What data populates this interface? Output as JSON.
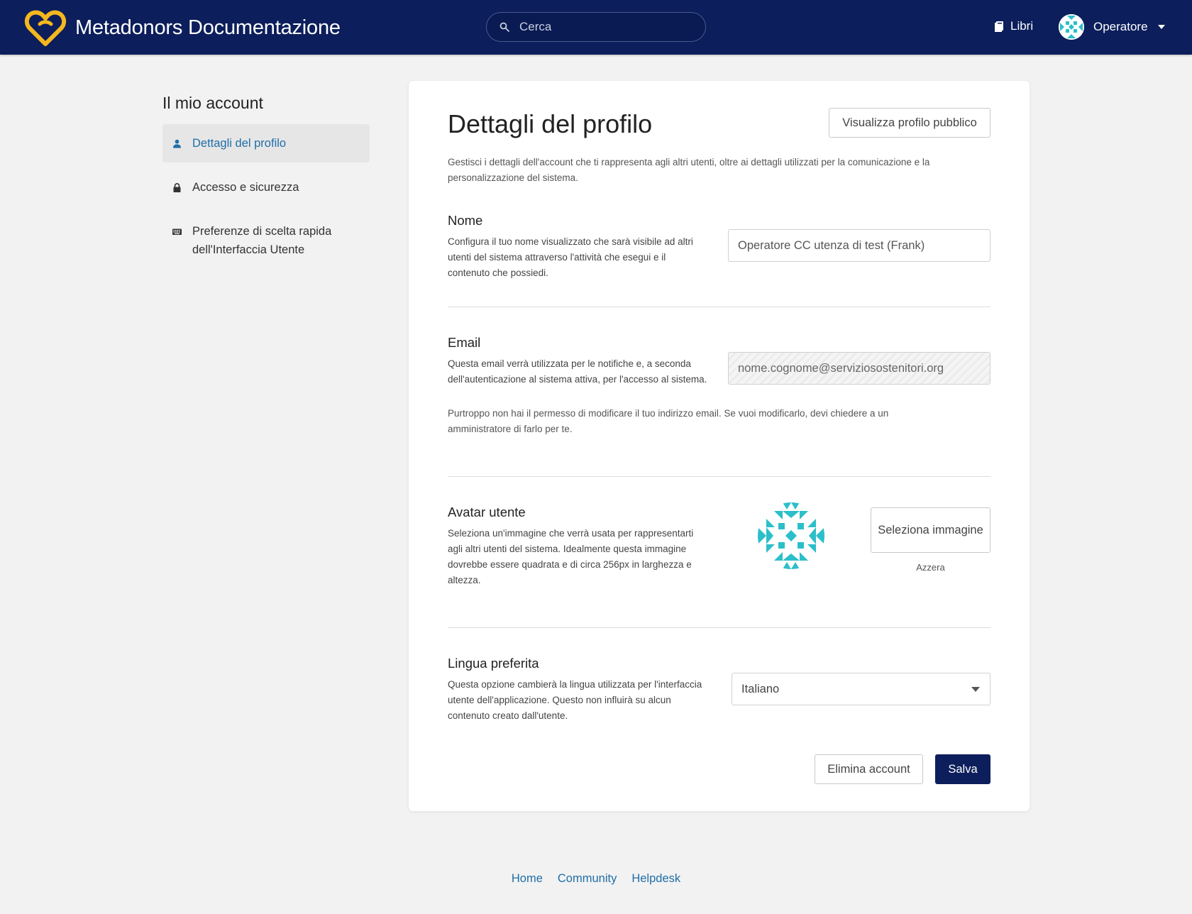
{
  "header": {
    "app_title": "Metadonors Documentazione",
    "search_placeholder": "Cerca",
    "books_link": "Libri",
    "user_name": "Operatore",
    "brand_color": "#0c1e5b",
    "logo_color": "#f5b71e"
  },
  "sidebar": {
    "title": "Il mio account",
    "items": [
      {
        "label": "Dettagli del profilo",
        "icon": "user-icon",
        "active": true
      },
      {
        "label": "Accesso e sicurezza",
        "icon": "lock-icon",
        "active": false
      },
      {
        "label": "Preferenze di scelta rapida dell'Interfaccia Utente",
        "icon": "keyboard-icon",
        "active": false
      }
    ]
  },
  "main": {
    "title": "Dettagli del profilo",
    "public_profile_button": "Visualizza profilo pubblico",
    "intro": "Gestisci i dettagli dell'account che ti rappresenta agli altri utenti, oltre ai dettagli utilizzati per la comunicazione e la personalizzazione del sistema.",
    "name_section": {
      "title": "Nome",
      "description": "Configura il tuo nome visualizzato che sarà visibile ad altri utenti del sistema attraverso l'attività che esegui e il contenuto che possiedi.",
      "value": "Operatore CC utenza di test (Frank)"
    },
    "email_section": {
      "title": "Email",
      "description": "Questa email verrà utilizzata per le notifiche e, a seconda dell'autenticazione al sistema attiva, per l'accesso al sistema.",
      "value": "nome.cognome@serviziosostenitori.org",
      "note": "Purtroppo non hai il permesso di modificare il tuo indirizzo email. Se vuoi modificarlo, devi chiedere a un amministratore di farlo per te."
    },
    "avatar_section": {
      "title": "Avatar utente",
      "description": "Seleziona un'immagine che verrà usata per rappresentarti agli altri utenti del sistema. Idealmente questa immagine dovrebbe essere quadrata e di circa 256px in larghezza e altezza.",
      "select_button": "Seleziona immagine",
      "reset_link": "Azzera",
      "avatar_color": "#2bbfc9"
    },
    "language_section": {
      "title": "Lingua preferita",
      "description": "Questa opzione cambierà la lingua utilizzata per l'interfaccia utente dell'applicazione. Questo non influirà su alcun contenuto creato dall'utente.",
      "selected": "Italiano"
    },
    "delete_button": "Elimina account",
    "save_button": "Salva"
  },
  "footer": {
    "links": [
      "Home",
      "Community",
      "Helpdesk"
    ],
    "link_color": "#206ea7"
  }
}
